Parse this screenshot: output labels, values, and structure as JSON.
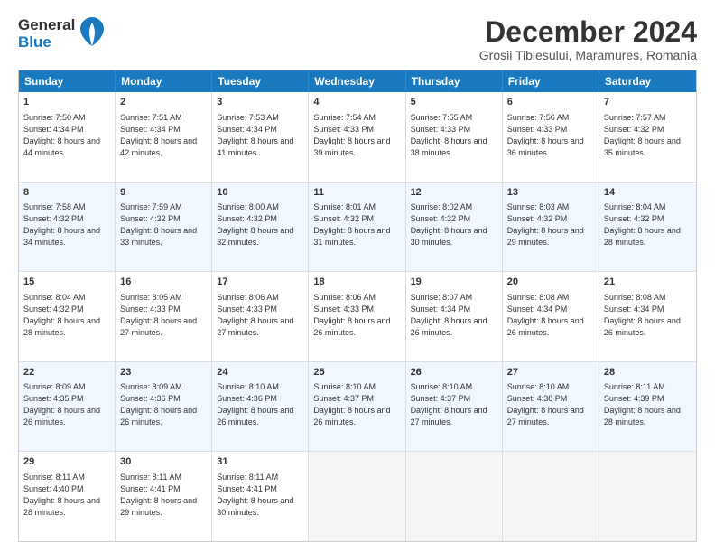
{
  "header": {
    "logo_general": "General",
    "logo_blue": "Blue",
    "title": "December 2024",
    "subtitle": "Grosii Tiblesului, Maramures, Romania"
  },
  "calendar": {
    "days": [
      "Sunday",
      "Monday",
      "Tuesday",
      "Wednesday",
      "Thursday",
      "Friday",
      "Saturday"
    ],
    "rows": [
      [
        {
          "day": "1",
          "sunrise": "Sunrise: 7:50 AM",
          "sunset": "Sunset: 4:34 PM",
          "daylight": "Daylight: 8 hours and 44 minutes."
        },
        {
          "day": "2",
          "sunrise": "Sunrise: 7:51 AM",
          "sunset": "Sunset: 4:34 PM",
          "daylight": "Daylight: 8 hours and 42 minutes."
        },
        {
          "day": "3",
          "sunrise": "Sunrise: 7:53 AM",
          "sunset": "Sunset: 4:34 PM",
          "daylight": "Daylight: 8 hours and 41 minutes."
        },
        {
          "day": "4",
          "sunrise": "Sunrise: 7:54 AM",
          "sunset": "Sunset: 4:33 PM",
          "daylight": "Daylight: 8 hours and 39 minutes."
        },
        {
          "day": "5",
          "sunrise": "Sunrise: 7:55 AM",
          "sunset": "Sunset: 4:33 PM",
          "daylight": "Daylight: 8 hours and 38 minutes."
        },
        {
          "day": "6",
          "sunrise": "Sunrise: 7:56 AM",
          "sunset": "Sunset: 4:33 PM",
          "daylight": "Daylight: 8 hours and 36 minutes."
        },
        {
          "day": "7",
          "sunrise": "Sunrise: 7:57 AM",
          "sunset": "Sunset: 4:32 PM",
          "daylight": "Daylight: 8 hours and 35 minutes."
        }
      ],
      [
        {
          "day": "8",
          "sunrise": "Sunrise: 7:58 AM",
          "sunset": "Sunset: 4:32 PM",
          "daylight": "Daylight: 8 hours and 34 minutes."
        },
        {
          "day": "9",
          "sunrise": "Sunrise: 7:59 AM",
          "sunset": "Sunset: 4:32 PM",
          "daylight": "Daylight: 8 hours and 33 minutes."
        },
        {
          "day": "10",
          "sunrise": "Sunrise: 8:00 AM",
          "sunset": "Sunset: 4:32 PM",
          "daylight": "Daylight: 8 hours and 32 minutes."
        },
        {
          "day": "11",
          "sunrise": "Sunrise: 8:01 AM",
          "sunset": "Sunset: 4:32 PM",
          "daylight": "Daylight: 8 hours and 31 minutes."
        },
        {
          "day": "12",
          "sunrise": "Sunrise: 8:02 AM",
          "sunset": "Sunset: 4:32 PM",
          "daylight": "Daylight: 8 hours and 30 minutes."
        },
        {
          "day": "13",
          "sunrise": "Sunrise: 8:03 AM",
          "sunset": "Sunset: 4:32 PM",
          "daylight": "Daylight: 8 hours and 29 minutes."
        },
        {
          "day": "14",
          "sunrise": "Sunrise: 8:04 AM",
          "sunset": "Sunset: 4:32 PM",
          "daylight": "Daylight: 8 hours and 28 minutes."
        }
      ],
      [
        {
          "day": "15",
          "sunrise": "Sunrise: 8:04 AM",
          "sunset": "Sunset: 4:32 PM",
          "daylight": "Daylight: 8 hours and 28 minutes."
        },
        {
          "day": "16",
          "sunrise": "Sunrise: 8:05 AM",
          "sunset": "Sunset: 4:33 PM",
          "daylight": "Daylight: 8 hours and 27 minutes."
        },
        {
          "day": "17",
          "sunrise": "Sunrise: 8:06 AM",
          "sunset": "Sunset: 4:33 PM",
          "daylight": "Daylight: 8 hours and 27 minutes."
        },
        {
          "day": "18",
          "sunrise": "Sunrise: 8:06 AM",
          "sunset": "Sunset: 4:33 PM",
          "daylight": "Daylight: 8 hours and 26 minutes."
        },
        {
          "day": "19",
          "sunrise": "Sunrise: 8:07 AM",
          "sunset": "Sunset: 4:34 PM",
          "daylight": "Daylight: 8 hours and 26 minutes."
        },
        {
          "day": "20",
          "sunrise": "Sunrise: 8:08 AM",
          "sunset": "Sunset: 4:34 PM",
          "daylight": "Daylight: 8 hours and 26 minutes."
        },
        {
          "day": "21",
          "sunrise": "Sunrise: 8:08 AM",
          "sunset": "Sunset: 4:34 PM",
          "daylight": "Daylight: 8 hours and 26 minutes."
        }
      ],
      [
        {
          "day": "22",
          "sunrise": "Sunrise: 8:09 AM",
          "sunset": "Sunset: 4:35 PM",
          "daylight": "Daylight: 8 hours and 26 minutes."
        },
        {
          "day": "23",
          "sunrise": "Sunrise: 8:09 AM",
          "sunset": "Sunset: 4:36 PM",
          "daylight": "Daylight: 8 hours and 26 minutes."
        },
        {
          "day": "24",
          "sunrise": "Sunrise: 8:10 AM",
          "sunset": "Sunset: 4:36 PM",
          "daylight": "Daylight: 8 hours and 26 minutes."
        },
        {
          "day": "25",
          "sunrise": "Sunrise: 8:10 AM",
          "sunset": "Sunset: 4:37 PM",
          "daylight": "Daylight: 8 hours and 26 minutes."
        },
        {
          "day": "26",
          "sunrise": "Sunrise: 8:10 AM",
          "sunset": "Sunset: 4:37 PM",
          "daylight": "Daylight: 8 hours and 27 minutes."
        },
        {
          "day": "27",
          "sunrise": "Sunrise: 8:10 AM",
          "sunset": "Sunset: 4:38 PM",
          "daylight": "Daylight: 8 hours and 27 minutes."
        },
        {
          "day": "28",
          "sunrise": "Sunrise: 8:11 AM",
          "sunset": "Sunset: 4:39 PM",
          "daylight": "Daylight: 8 hours and 28 minutes."
        }
      ],
      [
        {
          "day": "29",
          "sunrise": "Sunrise: 8:11 AM",
          "sunset": "Sunset: 4:40 PM",
          "daylight": "Daylight: 8 hours and 28 minutes."
        },
        {
          "day": "30",
          "sunrise": "Sunrise: 8:11 AM",
          "sunset": "Sunset: 4:41 PM",
          "daylight": "Daylight: 8 hours and 29 minutes."
        },
        {
          "day": "31",
          "sunrise": "Sunrise: 8:11 AM",
          "sunset": "Sunset: 4:41 PM",
          "daylight": "Daylight: 8 hours and 30 minutes."
        },
        null,
        null,
        null,
        null
      ]
    ]
  }
}
